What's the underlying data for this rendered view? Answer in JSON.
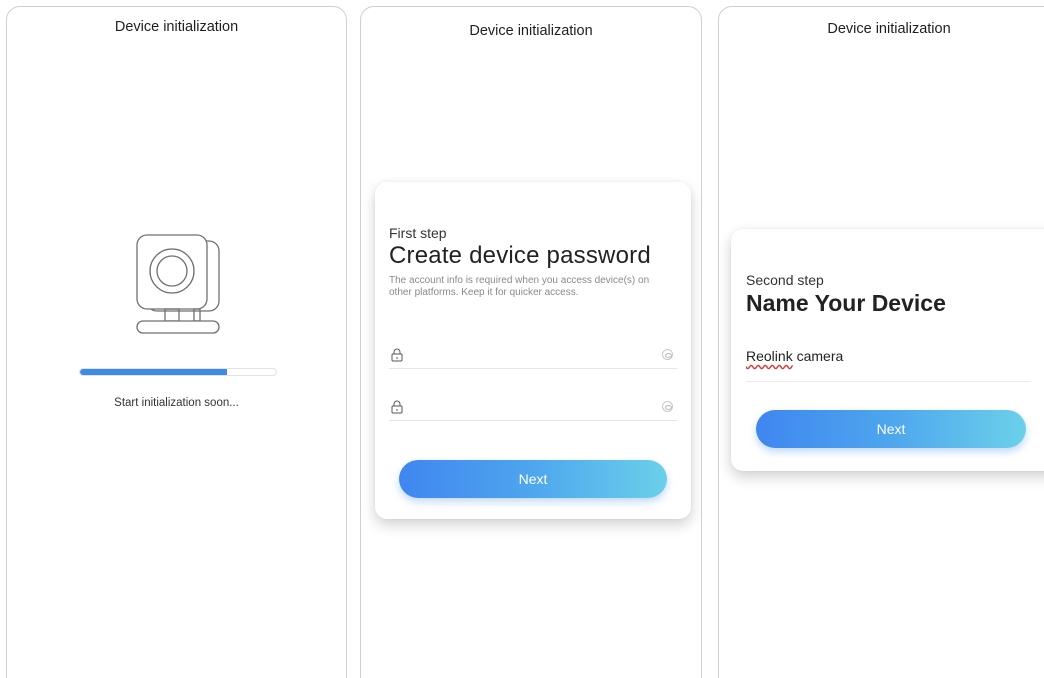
{
  "screens": [
    {
      "title": "Device initialization",
      "progress": 0.75,
      "status": "Start initialization soon..."
    },
    {
      "title": "Device initialization",
      "step_label": "First step",
      "heading": "Create device password",
      "description": "The account info is required when you access device(s) on other platforms. Keep it for quicker access.",
      "password_placeholder": "",
      "confirm_placeholder": "",
      "next_label": "Next"
    },
    {
      "title": "Device initialization",
      "step_label": "Second step",
      "heading": "Name Your Device",
      "device_name_word1": "Reolink",
      "device_name_word2": " camera",
      "next_label": "Next"
    }
  ],
  "colors": {
    "progress": "#3d8be6",
    "button_gradient_start": "#3f86f0",
    "button_gradient_end": "#6cd0ea"
  },
  "icons": [
    "camera-icon",
    "lock-icon",
    "eye-icon"
  ]
}
